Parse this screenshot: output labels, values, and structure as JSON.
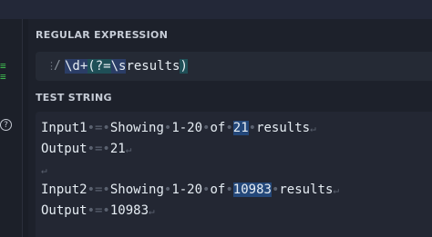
{
  "regex_section": {
    "label": "REGULAR EXPRESSION",
    "expression": "\\d+(?=\\sresults)"
  },
  "test_section": {
    "label": "TEST STRING",
    "lines": [
      {
        "pre": "Input1",
        "mid": "Showing",
        "range": "1-20",
        "of": "of",
        "match": "21",
        "post": "results"
      },
      {
        "pre": "Output",
        "value": "21"
      },
      {},
      {
        "pre": "Input2",
        "mid": "Showing",
        "range": "1-20",
        "of": "of",
        "match": "10983",
        "post": "results"
      },
      {
        "pre": "Output",
        "value": "10983"
      }
    ]
  },
  "colors": {
    "background": "#1a1e27",
    "match_highlight": "#24487a",
    "success_indicator": "#3fb950"
  },
  "icons": {
    "help": "question-circle-icon",
    "drag": "drag-handle-icon"
  }
}
